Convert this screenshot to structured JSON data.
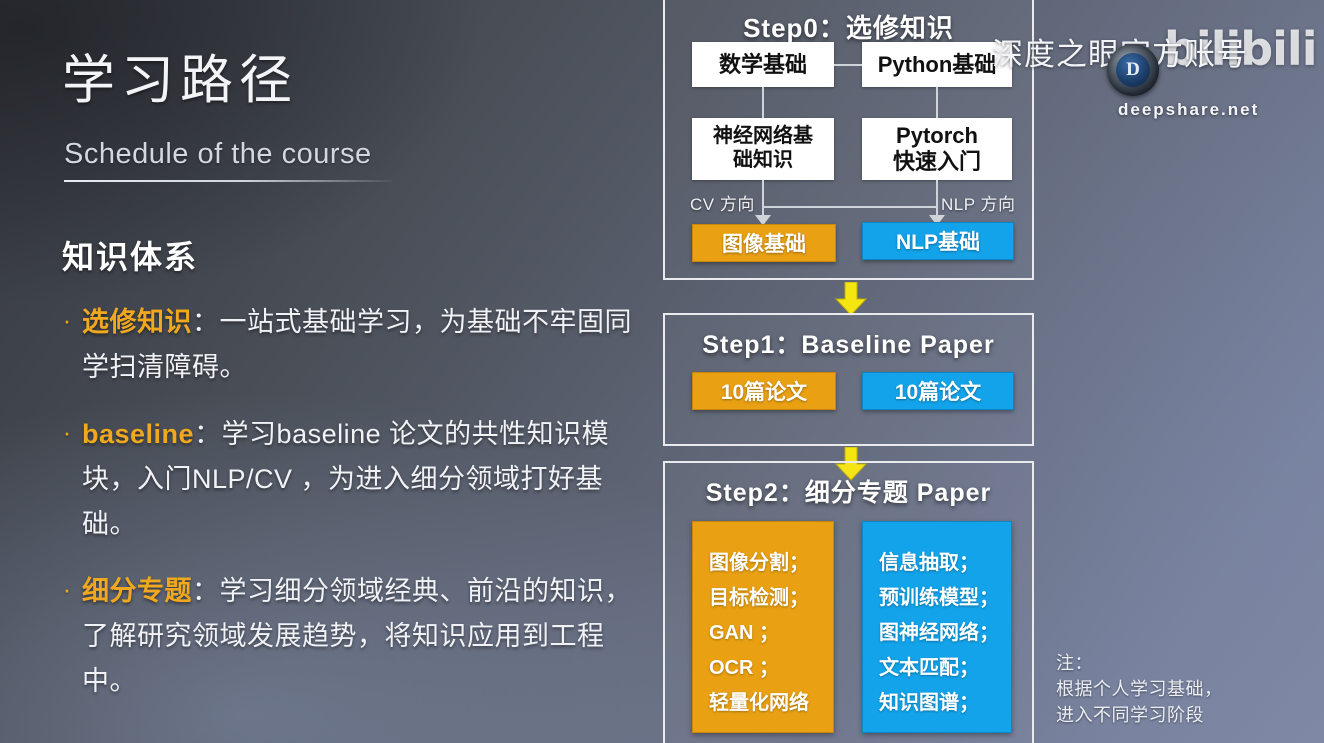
{
  "slide": {
    "title": "学习路径",
    "subtitle": "Schedule of the course",
    "section_heading": "知识体系",
    "bullet_marker": "·"
  },
  "bullets": [
    {
      "keyword": "选修知识",
      "separator": "：",
      "text": "一站式基础学习，为基础不牢固同学扫清障碍。"
    },
    {
      "keyword": "baseline",
      "separator": "：",
      "text": "学习baseline 论文的共性知识模块，入门NLP/CV ，为进入细分领域打好基础。"
    },
    {
      "keyword": "细分专题",
      "separator": "：",
      "text": "学习细分领域经典、前沿的知识，了解研究领域发展趋势，将知识应用到工程中。"
    }
  ],
  "flow": {
    "step0": {
      "title": "Step0：选修知识",
      "boxes": {
        "math": "数学基础",
        "python": "Python基础",
        "nn": "神经网络基础知识",
        "pytorch": "Pytorch\n快速入门"
      },
      "nn_line1": "神经网络基",
      "nn_line2": "础知识",
      "pytorch_line1": "Pytorch",
      "pytorch_line2": "快速入门",
      "direction_cv": "CV 方向",
      "direction_nlp": "NLP 方向",
      "target_cv": "图像基础",
      "target_nlp": "NLP基础"
    },
    "step1": {
      "title": "Step1：Baseline Paper",
      "papers_cv": "10篇论文",
      "papers_nlp": "10篇论文"
    },
    "step2": {
      "title": "Step2：细分专题 Paper",
      "cv_topics": "图像分割；\n目标检测；\nGAN ；\nOCR ；\n轻量化网络",
      "nlp_topics": "信息抽取；\n预训练模型；\n图神经网络；\n文本匹配；\n知识图谱；",
      "cv_topics_list": [
        "图像分割；",
        "目标检测；",
        "GAN ；",
        "OCR ；",
        "轻量化网络"
      ],
      "nlp_topics_list": [
        "信息抽取；",
        "预训练模型；",
        "图神经网络；",
        "文本匹配；",
        "知识图谱；"
      ]
    },
    "arrow_icon": "down-arrow-icon"
  },
  "note": {
    "line1": "注：",
    "line2": "根据个人学习基础，",
    "line3": "进入不同学习阶段"
  },
  "watermark": {
    "account_text": "深度之眼官方账号",
    "brand": "bilibili",
    "logo_letter": "D",
    "domain": "deepshare.net"
  },
  "colors": {
    "accent_orange": "#e9a012",
    "accent_blue": "#12a3ea",
    "arrow_yellow": "#f5e510",
    "text_light": "#f0f2f6",
    "bg_dark": "#35383e",
    "bg_light": "#8089a4"
  }
}
